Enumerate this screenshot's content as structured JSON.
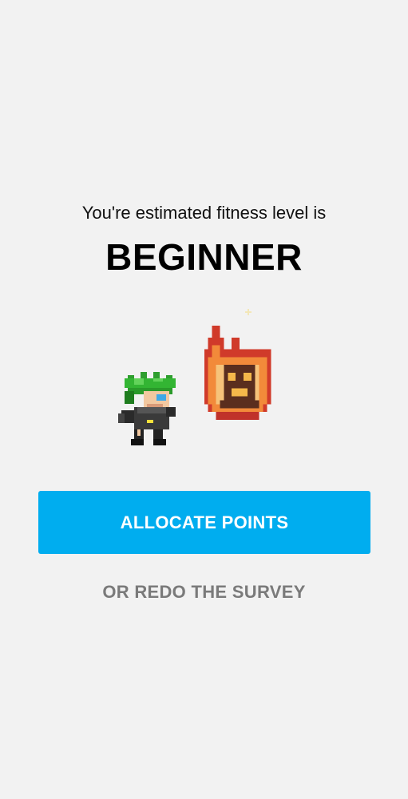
{
  "result": {
    "subtitle": "You're estimated fitness level is",
    "level": "BEGINNER"
  },
  "sprites": {
    "hero_icon": "hero-character-icon",
    "fire_icon": "fire-spirit-icon",
    "sparkle_icon": "sparkle-icon"
  },
  "actions": {
    "allocate_label": "ALLOCATE POINTS",
    "redo_label": "OR REDO THE SURVEY"
  },
  "colors": {
    "background": "#f2f2f2",
    "primary_button": "#00adef",
    "secondary_text": "#7a7a7a"
  }
}
